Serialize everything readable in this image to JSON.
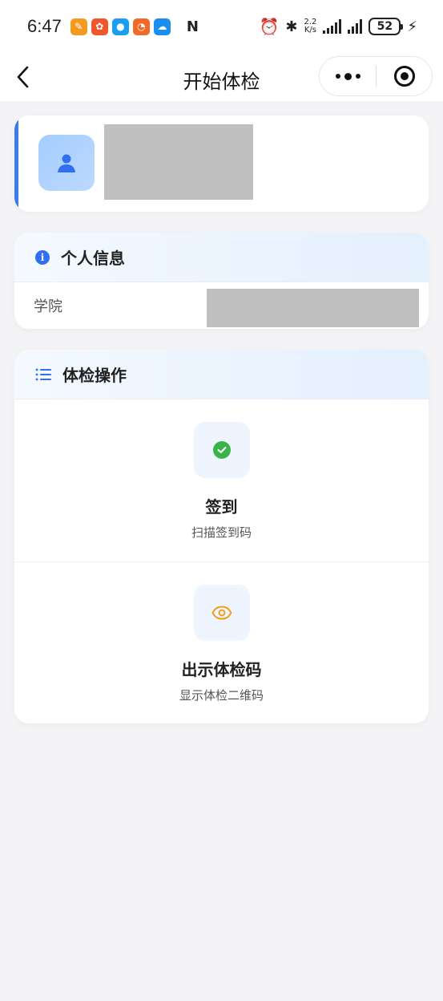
{
  "status_bar": {
    "time": "6:47",
    "net_speed_top": "2.2",
    "net_speed_bottom": "K/s",
    "battery": "52",
    "nfc_label": "N"
  },
  "nav": {
    "title": "开始体检"
  },
  "personal_info": {
    "title": "个人信息",
    "rows": [
      {
        "label": "学院"
      }
    ]
  },
  "operations": {
    "title": "体检操作",
    "items": [
      {
        "title": "签到",
        "subtitle": "扫描签到码",
        "icon": "check-circle-icon"
      },
      {
        "title": "出示体检码",
        "subtitle": "显示体检二维码",
        "icon": "eye-icon"
      }
    ]
  },
  "colors": {
    "accent": "#3a7bf0",
    "success": "#3bb24a",
    "warning": "#f0a020",
    "background": "#f4f4f6"
  }
}
